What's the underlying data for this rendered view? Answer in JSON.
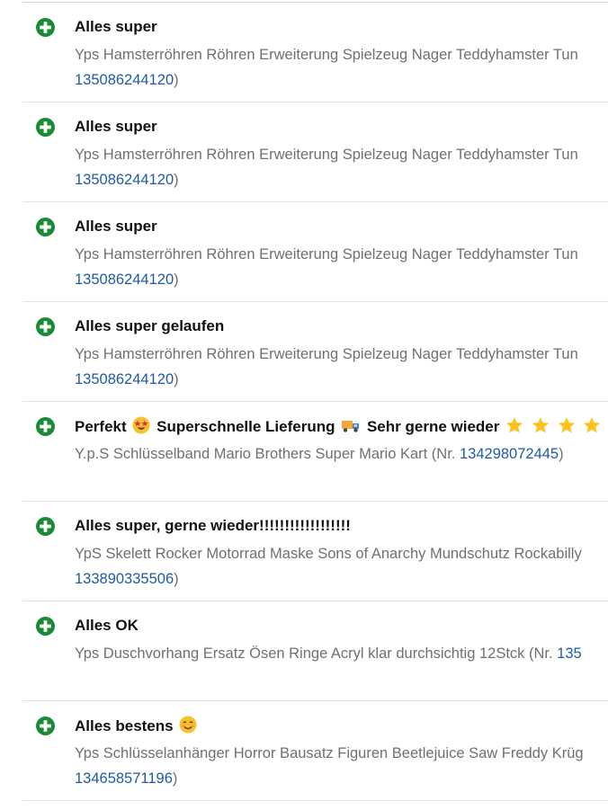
{
  "feedback": [
    {
      "comment": "Alles super",
      "item_title": "Yps Hamsterröhren Röhren Erweiterung Spielzeug Nager Teddyhamster Tun",
      "item_number": "135086244120",
      "nr_prefix": "",
      "close": ")"
    },
    {
      "comment": "Alles super",
      "item_title": "Yps Hamsterröhren Röhren Erweiterung Spielzeug Nager Teddyhamster Tun",
      "item_number": "135086244120",
      "nr_prefix": "",
      "close": ")"
    },
    {
      "comment": "Alles super",
      "item_title": "Yps Hamsterröhren Röhren Erweiterung Spielzeug Nager Teddyhamster Tun",
      "item_number": "135086244120",
      "nr_prefix": "",
      "close": ")"
    },
    {
      "comment": "Alles super gelaufen",
      "item_title": "Yps Hamsterröhren Röhren Erweiterung Spielzeug Nager Teddyhamster Tun",
      "item_number": "135086244120",
      "nr_prefix": "",
      "close": ")"
    },
    {
      "comment_part1": "Perfekt",
      "comment_part2": "Superschnelle Lieferung",
      "comment_part3": "Sehr gerne wieder",
      "item_title": "Y.p.S Schlüsselband Mario Brothers Super Mario Kart (Nr.",
      "item_number": "134298072445",
      "close": ")"
    },
    {
      "comment": "Alles super, gerne wieder!!!!!!!!!!!!!!!!!!",
      "item_title": "YpS Skelett Rocker Motorrad Maske Sons of Anarchy Mundschutz Rockabilly",
      "item_number": "133890335506",
      "close": ")"
    },
    {
      "comment": "Alles OK",
      "item_title": "Yps Duschvorhang Ersatz Ösen Ringe Acryl klar durchsichtig 12Stck (Nr.",
      "item_number": "135",
      "close": ""
    },
    {
      "comment": "Alles bestens",
      "item_title": "Yps Schlüsselanhänger Horror Bausatz Figuren Beetlejuice Saw Freddy Krüg",
      "item_number": "134658571196",
      "close": ")"
    }
  ],
  "colors": {
    "positive": "#1a8a35",
    "link": "#1f5aa6",
    "muted_text": "#707070",
    "divider": "#e2e2e2"
  },
  "icons": {
    "positive_rating": "plus-circle-icon",
    "emoji_star_struck": "star-struck-emoji-icon",
    "emoji_truck": "delivery-truck-emoji-icon",
    "emoji_star": "star-emoji-icon",
    "emoji_smile": "smiling-face-emoji-icon"
  }
}
